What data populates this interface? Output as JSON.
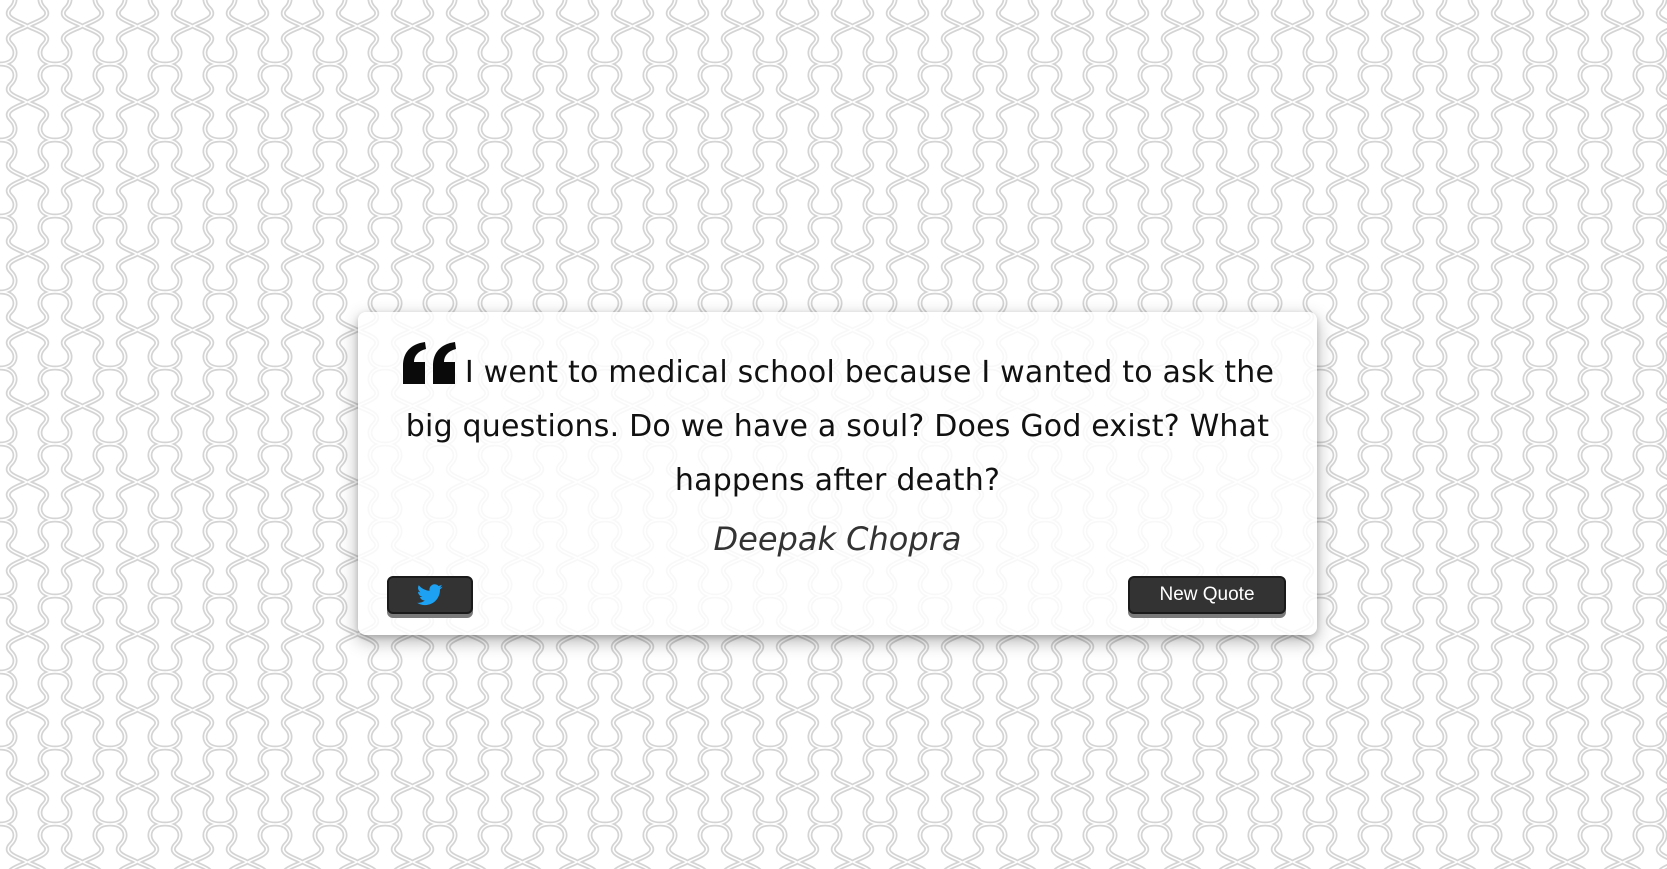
{
  "quote": {
    "text": "I went to medical school because I wanted to ask the big questions. Do we have a soul? Does God exist? What happens after death?",
    "author": "Deepak Chopra",
    "quote_icon": "quote-left-icon"
  },
  "actions": {
    "tweet_icon": "twitter-icon",
    "new_quote_label": "New Quote"
  },
  "colors": {
    "button_bg": "#333333",
    "twitter_blue": "#1da1f2",
    "pattern_stroke": "#d4d4d4"
  }
}
